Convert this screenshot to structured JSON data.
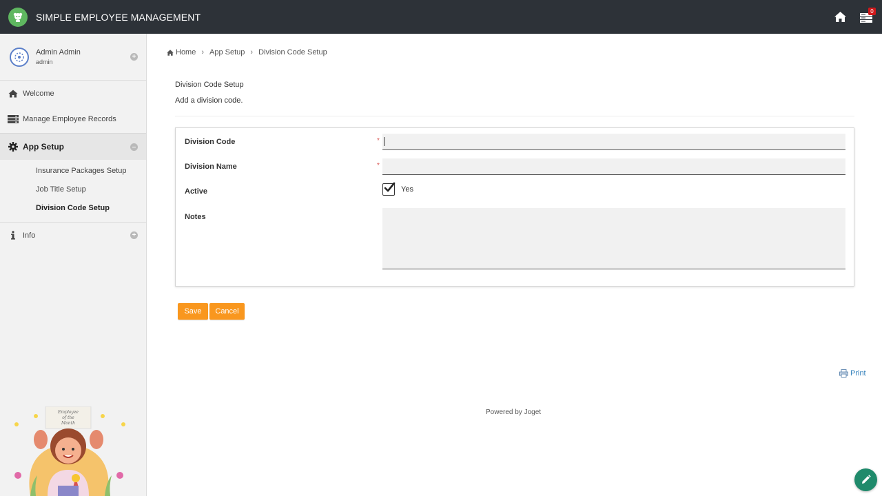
{
  "header": {
    "app_title": "SIMPLE EMPLOYEE MANAGEMENT",
    "logo_icon": "app-logo-icon",
    "home_icon": "home-icon",
    "inbox_icon": "inbox-icon",
    "inbox_count": "0"
  },
  "sidebar": {
    "profile": {
      "name": "Admin Admin",
      "username": "admin"
    },
    "items": [
      {
        "label": "Welcome",
        "icon": "home-icon"
      },
      {
        "label": "Manage Employee Records",
        "icon": "server-icon"
      }
    ],
    "section": {
      "label": "App Setup",
      "icon": "gear-icon",
      "sub_items": [
        {
          "label": "Insurance Packages Setup"
        },
        {
          "label": "Job Title Setup"
        },
        {
          "label": "Division Code Setup",
          "active": true
        }
      ]
    },
    "info": {
      "label": "Info",
      "icon": "info-icon"
    },
    "illustration_text": "Employee of the Month"
  },
  "breadcrumb": {
    "home": "Home",
    "sep1": "›",
    "app_setup": "App Setup",
    "sep2": "›",
    "current": "Division Code Setup"
  },
  "page": {
    "title": "Division Code Setup",
    "description": "Add a division code."
  },
  "form": {
    "division_code": {
      "label": "Division Code",
      "required": "*",
      "value": ""
    },
    "division_name": {
      "label": "Division Name",
      "required": "*",
      "value": ""
    },
    "active": {
      "label": "Active",
      "checked": true,
      "option_label": "Yes"
    },
    "notes": {
      "label": "Notes",
      "value": ""
    }
  },
  "buttons": {
    "save": "Save",
    "cancel": "Cancel"
  },
  "footer": {
    "print": "Print",
    "powered_by": "Powered by Joget"
  },
  "colors": {
    "topbar": "#2d3238",
    "accent_button": "#f9971e",
    "link": "#2a7bb8",
    "fab": "#1f8a6b",
    "logo": "#5fb760"
  }
}
